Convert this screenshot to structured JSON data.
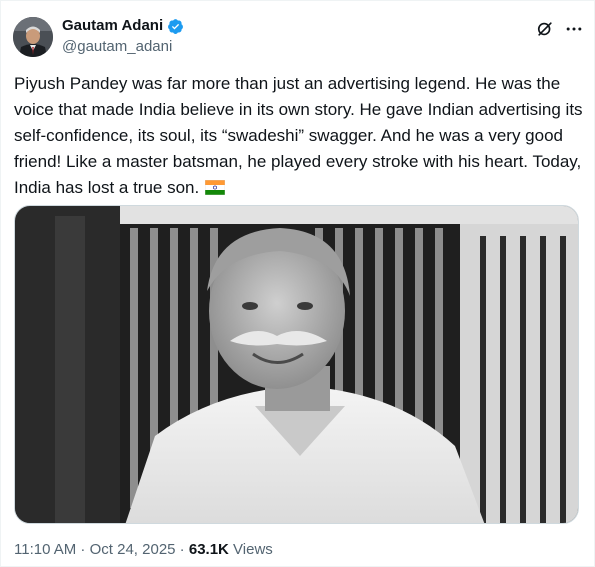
{
  "author": {
    "name": "Gautam Adani",
    "handle": "@gautam_adani",
    "verified": true,
    "badge_color": "#1d9bf0"
  },
  "icons": {
    "verified": "verified-badge-icon",
    "grok": "grok-icon",
    "more": "more-icon",
    "flag": "india-flag-icon"
  },
  "tweet": {
    "text": "Piyush Pandey was far more than just an advertising legend. He was the voice that made India believe in its own story. He gave Indian advertising its self-confidence, its soul, its “swadeshi” swagger. And he was a very good friend! Like a master batsman, he played every stroke with his heart. Today, India has lost a true son."
  },
  "meta": {
    "time": "11:10 AM",
    "sep1": " · ",
    "date": "Oct 24, 2025",
    "sep2": " · ",
    "views_count": "63.1K",
    "views_label": " Views"
  }
}
